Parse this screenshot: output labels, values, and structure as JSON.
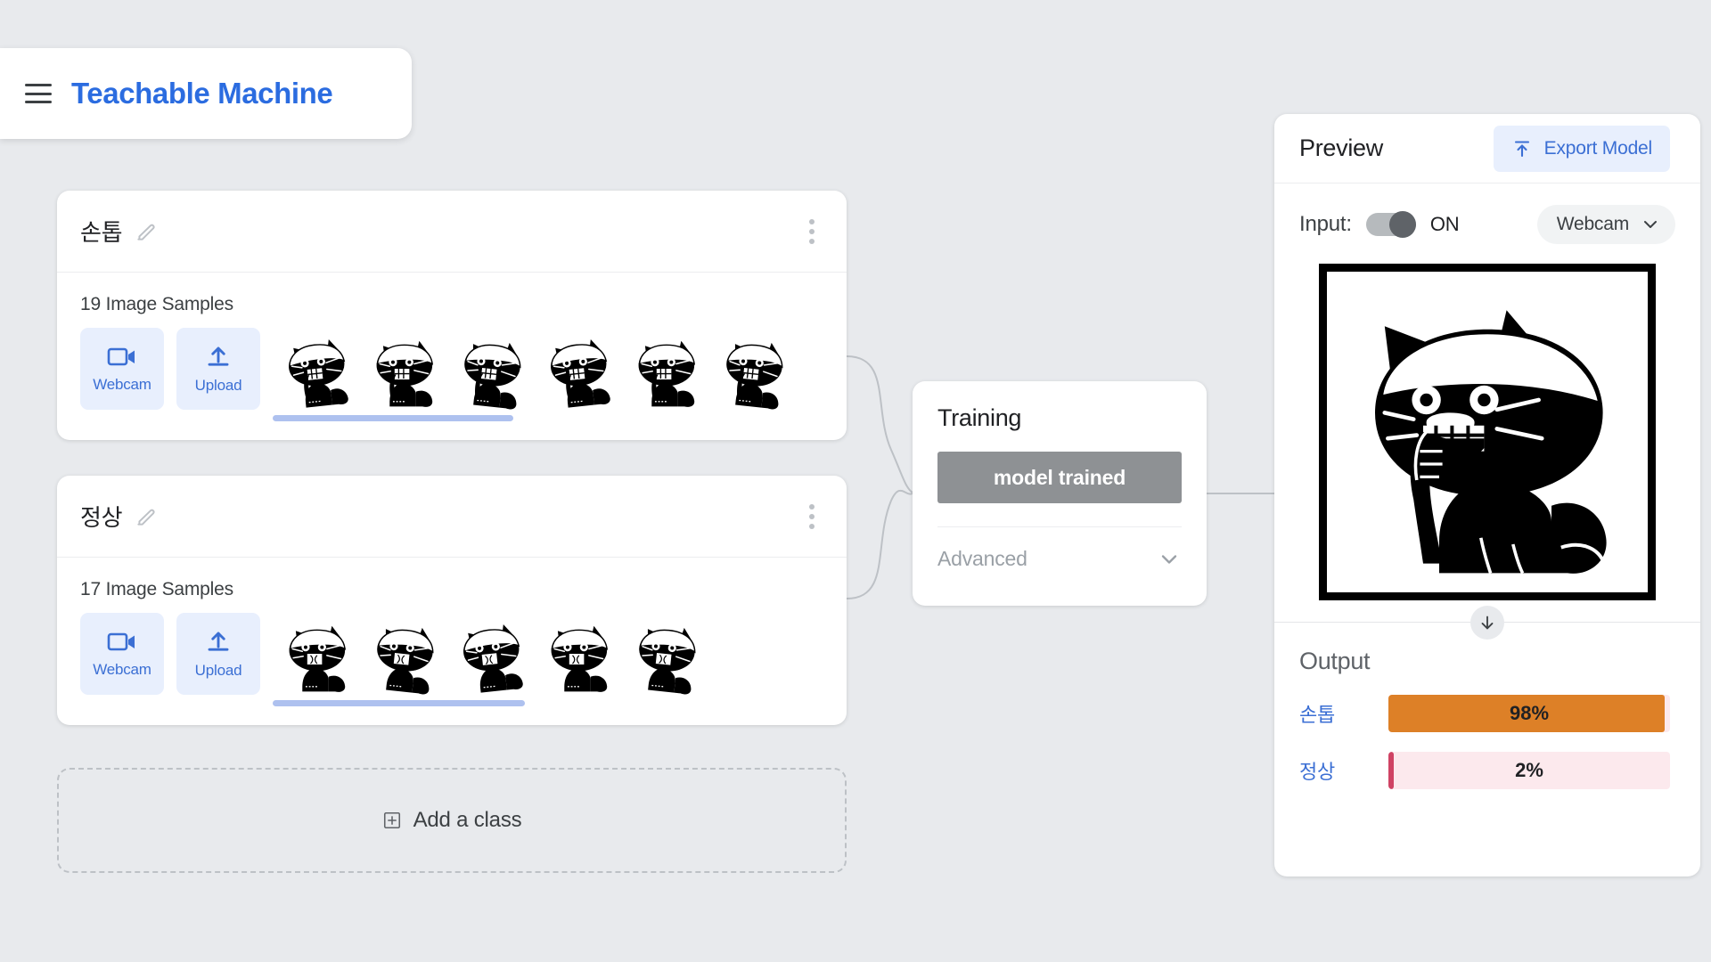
{
  "header": {
    "menu_icon": "hamburger-menu-icon",
    "brand": "Teachable Machine",
    "brand_color": "#2b6ce0"
  },
  "classes": [
    {
      "name": "손톱",
      "edit_icon": "pencil-icon",
      "menu_icon": "more-vertical-icon",
      "samples_text": "19 Image Samples",
      "sample_count": 19,
      "webcam_label": "Webcam",
      "upload_label": "Upload",
      "webcam_icon": "video-camera-icon",
      "upload_icon": "upload-icon",
      "thumb_count": 6,
      "thumb_kind": "cat-biting-nails",
      "scroll_pct": 42
    },
    {
      "name": "정상",
      "edit_icon": "pencil-icon",
      "menu_icon": "more-vertical-icon",
      "samples_text": "17 Image Samples",
      "sample_count": 17,
      "webcam_label": "Webcam",
      "upload_label": "Upload",
      "webcam_icon": "video-camera-icon",
      "upload_icon": "upload-icon",
      "thumb_count": 5,
      "thumb_kind": "cat-calm",
      "scroll_pct": 44
    }
  ],
  "add_class": {
    "label": "Add a class",
    "icon": "plus-box-icon"
  },
  "training": {
    "title": "Training",
    "button_label": "model trained",
    "button_color": "#8e9194",
    "advanced_label": "Advanced",
    "advanced_icon": "chevron-down-icon"
  },
  "preview": {
    "title": "Preview",
    "export_label": "Export Model",
    "export_icon": "export-upload-icon",
    "input_label": "Input:",
    "toggle_state": "ON",
    "toggle_on": true,
    "source_value": "Webcam",
    "source_icon": "chevron-down-icon",
    "webcam_image": "cat-biting-nails-preview",
    "flow_arrow_icon": "arrow-down-icon"
  },
  "output": {
    "title": "Output",
    "rows": [
      {
        "label": "손톱",
        "value": "98%",
        "pct": 98,
        "color": "#dd8027",
        "track": "#fce9ed"
      },
      {
        "label": "정상",
        "value": "2%",
        "pct": 2,
        "color": "#cf4364",
        "track": "#fce9ed"
      }
    ]
  }
}
